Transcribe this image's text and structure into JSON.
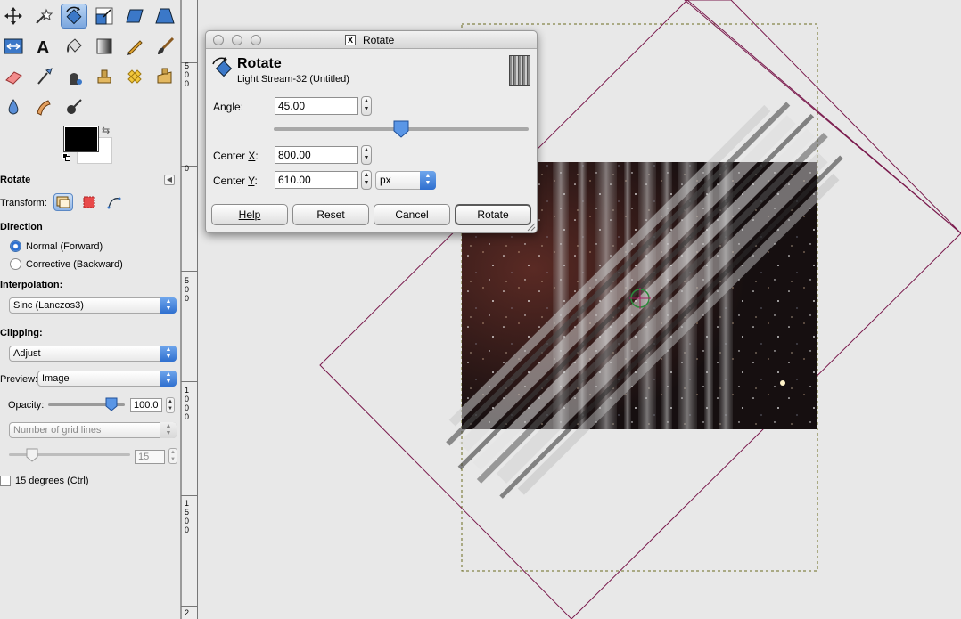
{
  "toolbox": {
    "tools": [
      {
        "name": "move-tool-icon",
        "active": false
      },
      {
        "name": "fuzzy-select-tool-icon",
        "active": false
      },
      {
        "name": "rotate-tool-icon",
        "active": true
      },
      {
        "name": "scale-tool-icon",
        "active": false
      },
      {
        "name": "shear-tool-icon",
        "active": false
      },
      {
        "name": "perspective-tool-icon",
        "active": false
      },
      {
        "name": "flip-tool-icon",
        "active": false
      },
      {
        "name": "text-tool-icon",
        "active": false
      },
      {
        "name": "bucket-fill-tool-icon",
        "active": false
      },
      {
        "name": "blend-tool-icon",
        "active": false
      },
      {
        "name": "pencil-tool-icon",
        "active": false
      },
      {
        "name": "paintbrush-tool-icon",
        "active": false
      },
      {
        "name": "eraser-tool-icon",
        "active": false
      },
      {
        "name": "airbrush-tool-icon",
        "active": false
      },
      {
        "name": "ink-tool-icon",
        "active": false
      },
      {
        "name": "clone-tool-icon",
        "active": false
      },
      {
        "name": "heal-tool-icon",
        "active": false
      },
      {
        "name": "perspective-clone-tool-icon",
        "active": false
      },
      {
        "name": "blur-tool-icon",
        "active": false
      },
      {
        "name": "smudge-tool-icon",
        "active": false
      },
      {
        "name": "dodge-burn-tool-icon",
        "active": false
      }
    ],
    "colors": {
      "foreground": "#000000",
      "background": "#ffffff"
    }
  },
  "tool_options": {
    "title": "Rotate",
    "transform_label": "Transform:",
    "direction_label": "Direction",
    "direction_forward": "Normal (Forward)",
    "direction_backward": "Corrective (Backward)",
    "interpolation_label": "Interpolation:",
    "interpolation_value": "Sinc (Lanczos3)",
    "clipping_label": "Clipping:",
    "clipping_value": "Adjust",
    "preview_label": "Preview:",
    "preview_value": "Image",
    "opacity_label": "Opacity:",
    "opacity_value": "100.0",
    "grid_value": "Number of grid lines",
    "grid_count": "15",
    "constrain_label": "15 degrees  (Ctrl)"
  },
  "ruler": {
    "labels": [
      "5",
      "0",
      "0",
      "0",
      "5",
      "0",
      "0",
      "1",
      "0",
      "0",
      "0",
      "1",
      "5",
      "0",
      "0",
      "2"
    ]
  },
  "dialog": {
    "window_title": "Rotate",
    "heading": "Rotate",
    "subheading": "Light Stream-32 (Untitled)",
    "angle_label": "Angle:",
    "angle_value": "45.00",
    "angle_fraction": 0.5,
    "center_x_label_a": "Center ",
    "center_x_label_u": "X",
    "center_x_label_b": ":",
    "center_x_value": "800.00",
    "center_y_label_a": "Center ",
    "center_y_label_u": "Y",
    "center_y_label_b": ":",
    "center_y_value": "610.00",
    "unit_value": "px",
    "buttons": {
      "help": "Help",
      "reset": "Reset",
      "cancel": "Cancel",
      "rotate": "Rotate"
    }
  },
  "accent_color": "#2f6fcf",
  "guide_color": "#7a1a4d"
}
